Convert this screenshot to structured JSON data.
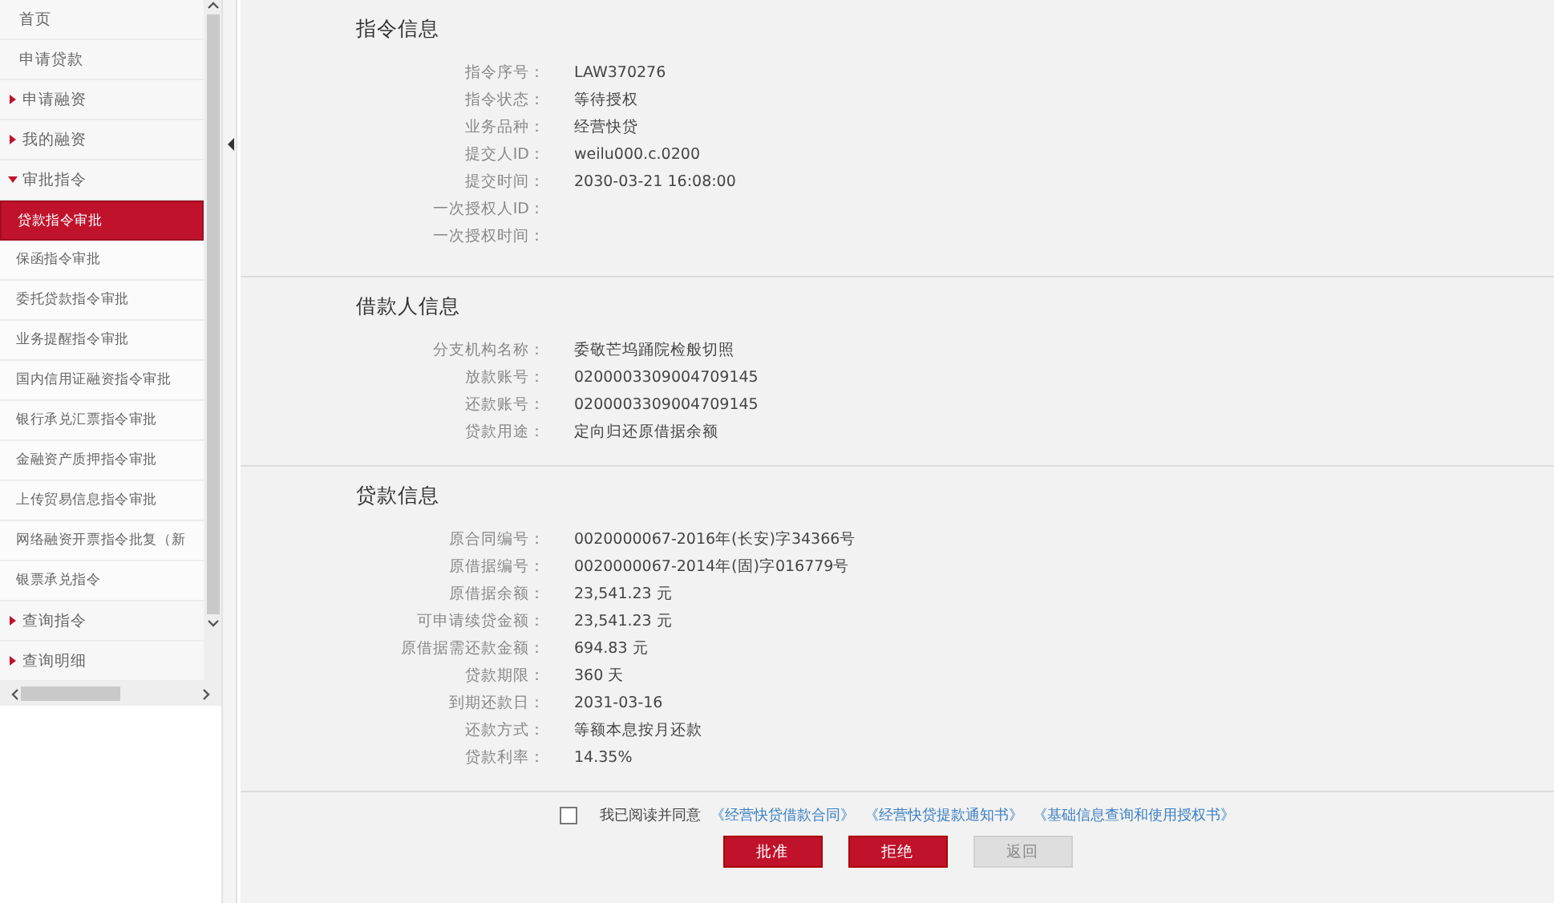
{
  "sidebar": {
    "items": [
      {
        "label": "首页",
        "kind": "plain",
        "selected": false
      },
      {
        "label": "申请贷款",
        "kind": "plain",
        "selected": false
      },
      {
        "label": "申请融资",
        "kind": "group",
        "expanded": false,
        "selected": false
      },
      {
        "label": "我的融资",
        "kind": "group",
        "expanded": false,
        "selected": false
      },
      {
        "label": "审批指令",
        "kind": "group",
        "expanded": true,
        "selected": false,
        "children": [
          {
            "label": "贷款指令审批",
            "selected": true
          },
          {
            "label": "保函指令审批",
            "selected": false
          },
          {
            "label": "委托贷款指令审批",
            "selected": false
          },
          {
            "label": "业务提醒指令审批",
            "selected": false
          },
          {
            "label": "国内信用证融资指令审批",
            "selected": false
          },
          {
            "label": "银行承兑汇票指令审批",
            "selected": false
          },
          {
            "label": "金融资产质押指令审批",
            "selected": false
          },
          {
            "label": "上传贸易信息指令审批",
            "selected": false
          },
          {
            "label": "网络融资开票指令批复（新",
            "selected": false
          },
          {
            "label": "银票承兑指令",
            "selected": false
          }
        ]
      },
      {
        "label": "查询指令",
        "kind": "group",
        "expanded": false,
        "selected": false
      },
      {
        "label": "查询明细",
        "kind": "group",
        "expanded": false,
        "selected": false
      }
    ]
  },
  "sections": [
    {
      "title": "指令信息",
      "fields": [
        {
          "label": "指令序号：",
          "value": "LAW370276"
        },
        {
          "label": "指令状态：",
          "value": "等待授权"
        },
        {
          "label": "业务品种：",
          "value": "经营快贷"
        },
        {
          "label": "提交人ID：",
          "value": "weilu000.c.0200"
        },
        {
          "label": "提交时间：",
          "value": "2030-03-21 16:08:00"
        },
        {
          "label": "一次授权人ID："
        },
        {
          "label": "一次授权时间："
        }
      ]
    },
    {
      "title": "借款人信息",
      "fields": [
        {
          "label": "分支机构名称：",
          "value": "委敬芒坞踊院检般切照"
        },
        {
          "label": "放款账号：",
          "value": "0200003309004709145"
        },
        {
          "label": "还款账号：",
          "value": "0200003309004709145"
        },
        {
          "label": "贷款用途：",
          "value": "定向归还原借据余额"
        }
      ]
    },
    {
      "title": "贷款信息",
      "fields": [
        {
          "label": "原合同编号：",
          "value": "0020000067-2016年(长安)字34366号"
        },
        {
          "label": "原借据编号：",
          "value": "0020000067-2014年(固)字016779号"
        },
        {
          "label": "原借据余额：",
          "value": "23,541.23 元"
        },
        {
          "label": "可申请续贷金额：",
          "value": "23,541.23 元"
        },
        {
          "label": "原借据需还款金额：",
          "value": "694.83 元"
        },
        {
          "label": "贷款期限：",
          "value": "360 天"
        },
        {
          "label": "到期还款日：",
          "value": "2031-03-16"
        },
        {
          "label": "还款方式：",
          "value": "等额本息按月还款"
        },
        {
          "label": "贷款利率：",
          "value": "14.35%"
        }
      ]
    }
  ],
  "agreement": {
    "checked": false,
    "text": "我已阅读并同意",
    "links": [
      "《经营快贷借款合同》",
      "《经营快贷提款通知书》",
      "《基础信息查询和使用授权书》"
    ]
  },
  "buttons": [
    {
      "label": "批准",
      "kind": "primary"
    },
    {
      "label": "拒绝",
      "kind": "primary"
    },
    {
      "label": "返回",
      "kind": "disabled"
    }
  ]
}
